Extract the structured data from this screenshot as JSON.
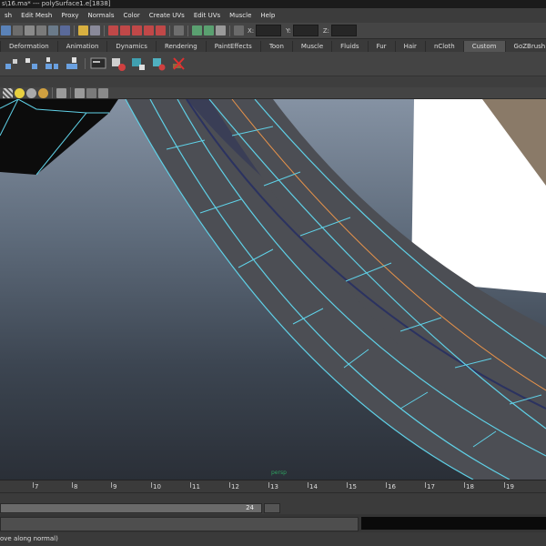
{
  "window": {
    "title": "s\\16.ma*  ---  polySurface1.e[1838]"
  },
  "menus": [
    "sh",
    "Edit Mesh",
    "Proxy",
    "Normals",
    "Color",
    "Create UVs",
    "Edit UVs",
    "Muscle",
    "Help"
  ],
  "status_line": {
    "x_label": "X:",
    "y_label": "Y:",
    "z_label": "Z:"
  },
  "shelf_tabs": [
    "Deformation",
    "Animation",
    "Dynamics",
    "Rendering",
    "PaintEffects",
    "Toon",
    "Muscle",
    "Fluids",
    "Fur",
    "Hair",
    "nCloth",
    "Custom",
    "GoZBrush"
  ],
  "shelf_tabs_active": "Custom",
  "shelf_icons": [
    "cluster-icon",
    "lattice-icon",
    "nonlinear-icon",
    "wrap-icon",
    "blend-icon",
    "soft-mod-icon",
    "paint-weights-icon",
    "particle-icon",
    "delete-icon"
  ],
  "viewport": {
    "axis_label": "persp"
  },
  "timeline": {
    "ticks": [
      "7",
      "8",
      "9",
      "10",
      "11",
      "12",
      "13",
      "14",
      "15",
      "16",
      "17",
      "18",
      "19"
    ],
    "current_frame": "24"
  },
  "help_line": "ove along normal)",
  "colors": {
    "wireframe": "#5fd0e6",
    "edge_highlight": "#e8934a",
    "surface": "#4c4e54"
  }
}
